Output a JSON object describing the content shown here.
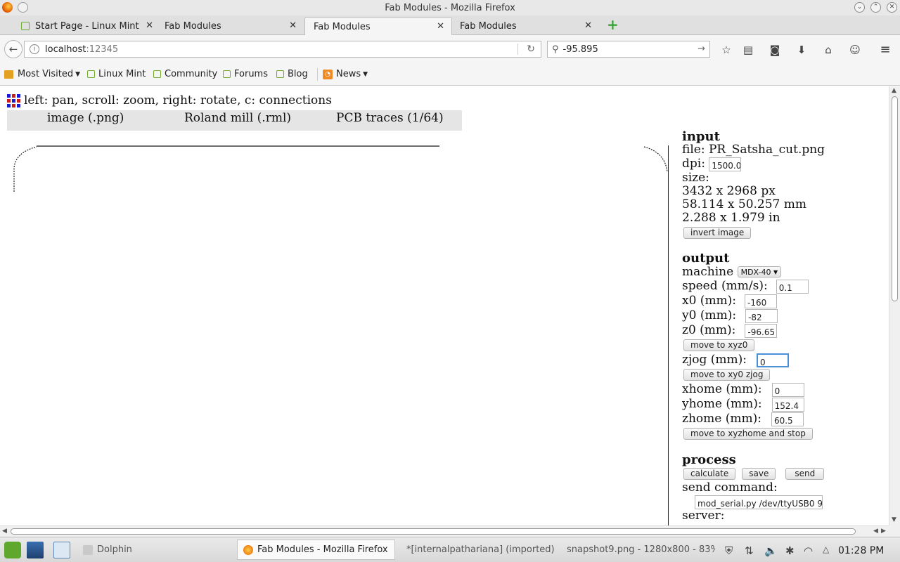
{
  "window": {
    "title": "Fab Modules - Mozilla Firefox"
  },
  "tabs": [
    {
      "label": "Start Page - Linux Mint"
    },
    {
      "label": "Fab Modules"
    },
    {
      "label": "Fab Modules"
    },
    {
      "label": "Fab Modules"
    }
  ],
  "nav": {
    "url_host": "localhost",
    "url_port": ":12345",
    "search_value": "-95.895"
  },
  "bookmarks": {
    "most_visited": "Most Visited",
    "linux_mint": "Linux Mint",
    "community": "Community",
    "forums": "Forums",
    "blog": "Blog",
    "news": "News"
  },
  "page": {
    "help_text": "left: pan, scroll: zoom, right: rotate, c: connections",
    "modules": [
      "image (.png)",
      "Roland mill (.rml)",
      "PCB traces (1/64)"
    ],
    "input": {
      "heading": "input",
      "file_label": "file:",
      "file_name": "PR_Satsha_cut.png",
      "dpi_label": "dpi:",
      "dpi_value": "1500.0",
      "size_label": "size:",
      "size_px": "3432 x 2968 px",
      "size_mm": "58.114 x 50.257 mm",
      "size_in": "2.288 x 1.979 in",
      "invert_button": "invert image"
    },
    "output": {
      "heading": "output",
      "machine_label": "machine",
      "machine_value": "MDX-40",
      "speed_label": "speed (mm/s):",
      "speed_value": "0.1",
      "x0_label": "x0 (mm):",
      "x0_value": "-160",
      "y0_label": "y0 (mm):",
      "y0_value": "-82",
      "z0_label": "z0 (mm):",
      "z0_value": "-96.65",
      "move_xyz0_button": "move to xyz0",
      "zjog_label": "zjog (mm):",
      "zjog_value": "0",
      "move_xy0_zjog_button": "move to xy0 zjog",
      "xhome_label": "xhome (mm):",
      "xhome_value": "0",
      "yhome_label": "yhome (mm):",
      "yhome_value": "152.4",
      "zhome_label": "zhome (mm):",
      "zhome_value": "60.5",
      "move_home_button": "move to xyzhome and stop"
    },
    "process": {
      "heading": "process",
      "calculate_button": "calculate",
      "save_button": "save",
      "send_button": "send",
      "send_command_label": "send command:",
      "send_command_value": "mod_serial.py /dev/ttyUSB0 9",
      "server_label": "server:"
    }
  },
  "taskbar": {
    "dolphin": "Dolphin",
    "firefox": "Fab Modules - Mozilla Firefox",
    "gimp": "*[internalpathariana] (imported)-",
    "snapshot": "snapshot9.png - 1280x800 - 83%",
    "clock": "01:28 PM"
  }
}
